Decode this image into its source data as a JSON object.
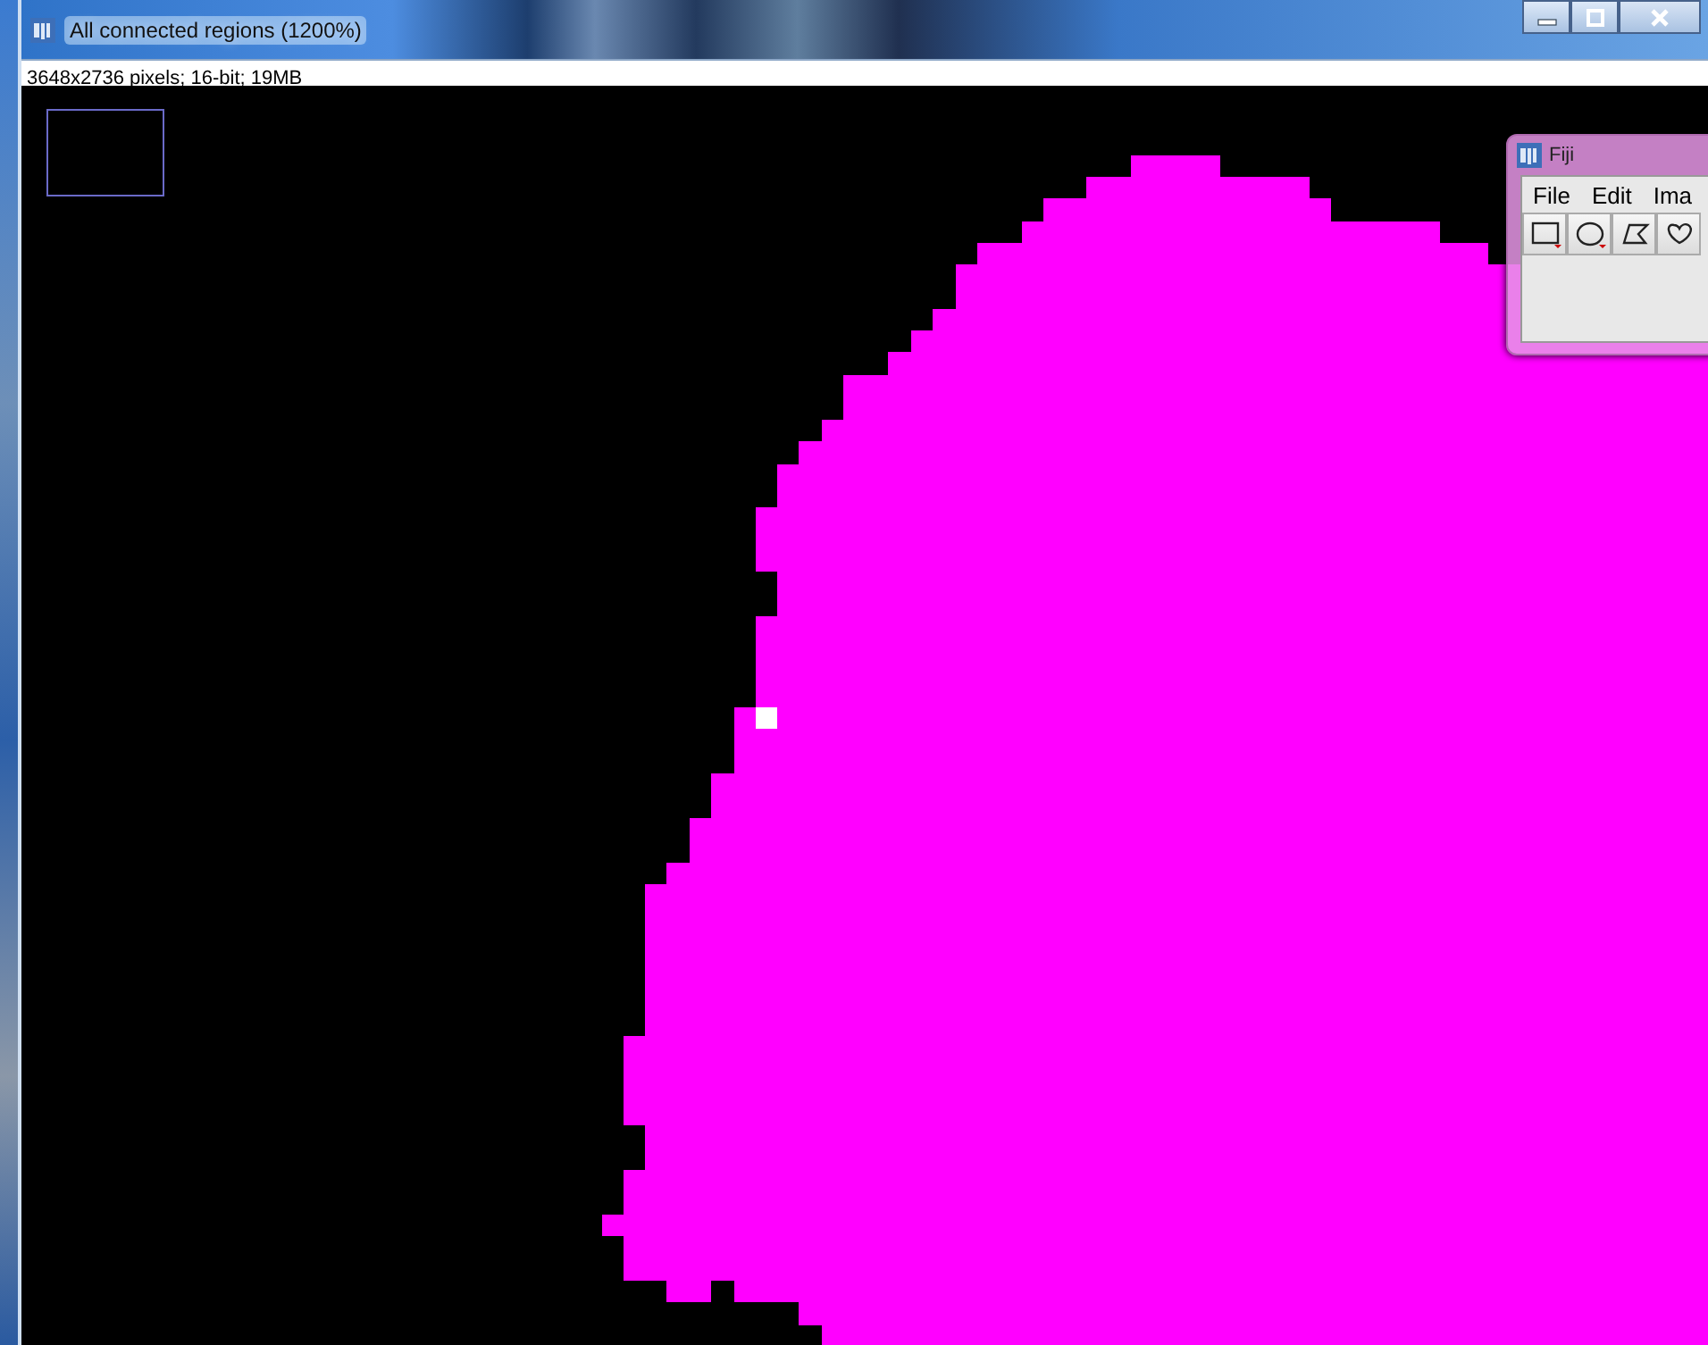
{
  "window": {
    "title": "All connected regions (1200%)"
  },
  "image_info": "3648x2736 pixels; 16-bit; 19MB",
  "fiji_window": {
    "title": "Fiji",
    "menus": [
      "File",
      "Edit",
      "Ima"
    ],
    "tools": [
      {
        "kind": "rectangle"
      },
      {
        "kind": "oval"
      },
      {
        "kind": "polygon"
      },
      {
        "kind": "freehand"
      }
    ]
  }
}
